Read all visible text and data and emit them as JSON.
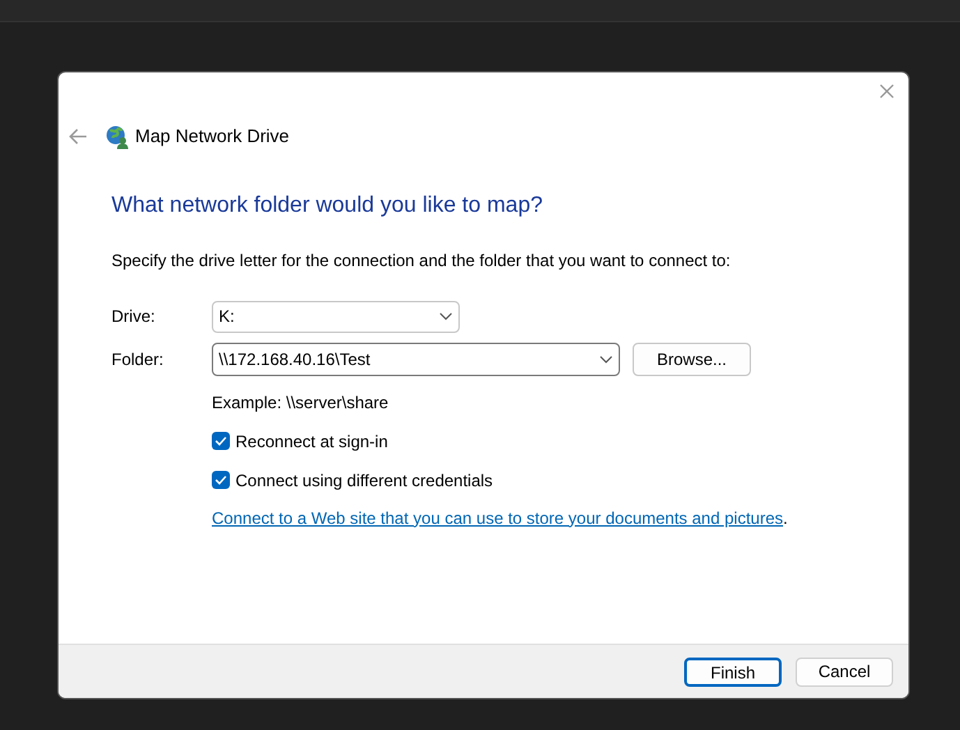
{
  "window": {
    "title": "Map Network Drive"
  },
  "heading": "What network folder would you like to map?",
  "description": "Specify the drive letter for the connection and the folder that you want to connect to:",
  "drive": {
    "label": "Drive:",
    "value": "K:"
  },
  "folder": {
    "label": "Folder:",
    "value": "\\\\172.168.40.16\\Test",
    "browse": "Browse..."
  },
  "example": "Example: \\\\server\\share",
  "checkboxes": [
    {
      "label": "Reconnect at sign-in",
      "checked": true
    },
    {
      "label": "Connect using different credentials",
      "checked": true
    }
  ],
  "link": {
    "text": "Connect to a Web site that you can use to store your documents and pictures",
    "after": "."
  },
  "buttons": [
    {
      "label": "Finish",
      "default": true
    },
    {
      "label": "Cancel",
      "default": false
    }
  ]
}
